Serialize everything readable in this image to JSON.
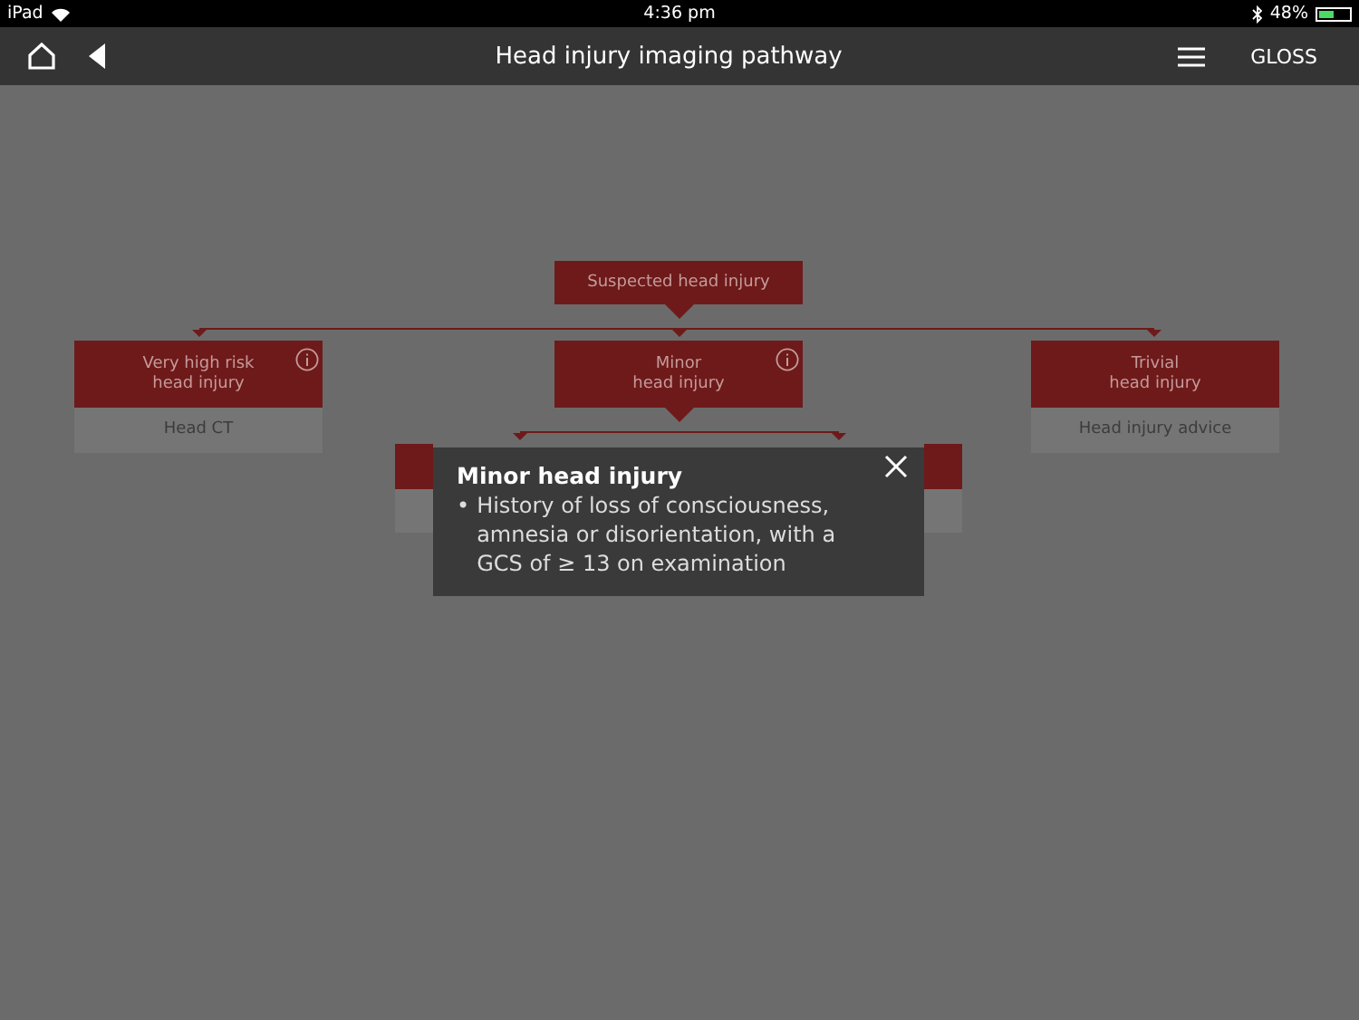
{
  "status_bar": {
    "device": "iPad",
    "time": "4:36 pm",
    "battery": "48%"
  },
  "nav_bar": {
    "title": "Head injury imaging pathway",
    "gloss": "GLOSS"
  },
  "flowchart": {
    "root": "Suspected head injury",
    "categories": [
      {
        "title": "Very high risk\nhead injury",
        "outcome": "Head CT",
        "info": true
      },
      {
        "title": "Minor\nhead injury",
        "info": true
      },
      {
        "title": "Trivial\nhead injury",
        "outcome": "Head injury advice",
        "info": false
      }
    ]
  },
  "popup": {
    "title": "Minor head injury",
    "bullet": "•",
    "text": "History of loss of consciousness, amnesia or disorientation, with a GCS of ≥ 13 on examination"
  }
}
